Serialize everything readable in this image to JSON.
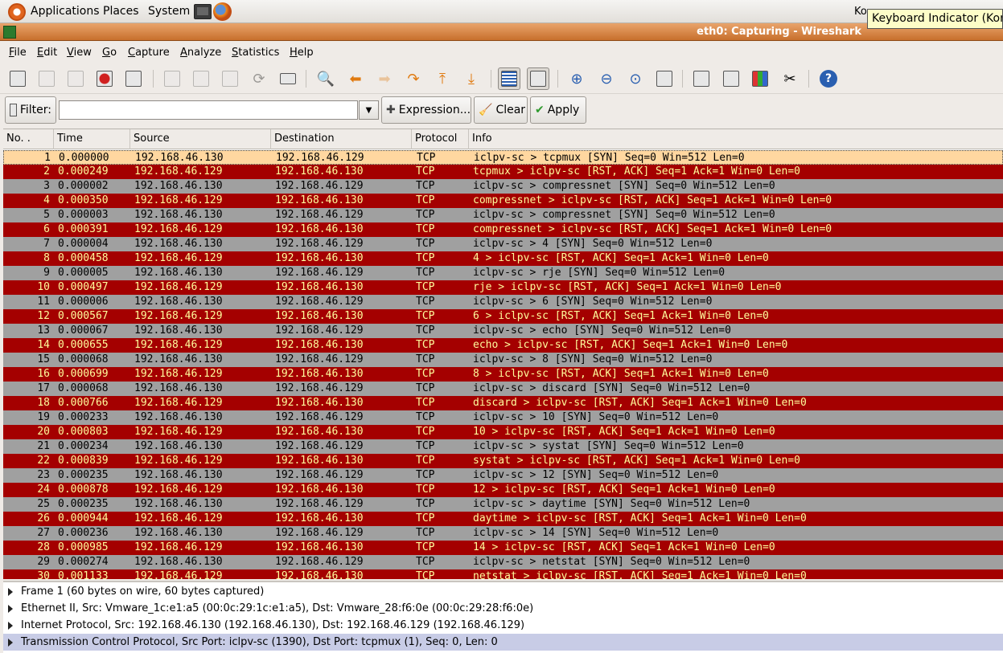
{
  "topbar": {
    "menus": [
      "Applications",
      "Places",
      "System"
    ],
    "tray_text": "Ko",
    "tooltip": "Keyboard Indicator (Korea"
  },
  "window": {
    "title": "eth0: Capturing - Wireshark"
  },
  "menubar": [
    "File",
    "Edit",
    "View",
    "Go",
    "Capture",
    "Analyze",
    "Statistics",
    "Help"
  ],
  "filterbar": {
    "filter_label": "Filter:",
    "filter_value": "",
    "expression_label": "Expression...",
    "clear_label": "Clear",
    "apply_label": "Apply"
  },
  "columns": [
    "No. .",
    "Time",
    "Source",
    "Destination",
    "Protocol",
    "Info"
  ],
  "packets": [
    {
      "no": "1",
      "time": "0.000000",
      "src": "192.168.46.130",
      "dst": "192.168.46.129",
      "proto": "TCP",
      "info": "iclpv-sc > tcpmux [SYN] Seq=0 Win=512 Len=0",
      "kind": "sel"
    },
    {
      "no": "2",
      "time": "0.000249",
      "src": "192.168.46.129",
      "dst": "192.168.46.130",
      "proto": "TCP",
      "info": "tcpmux > iclpv-sc [RST, ACK] Seq=1 Ack=1 Win=0 Len=0",
      "kind": "rst"
    },
    {
      "no": "3",
      "time": "0.000002",
      "src": "192.168.46.130",
      "dst": "192.168.46.129",
      "proto": "TCP",
      "info": "iclpv-sc > compressnet [SYN] Seq=0 Win=512 Len=0",
      "kind": "syn"
    },
    {
      "no": "4",
      "time": "0.000350",
      "src": "192.168.46.129",
      "dst": "192.168.46.130",
      "proto": "TCP",
      "info": "compressnet > iclpv-sc [RST, ACK] Seq=1 Ack=1 Win=0 Len=0",
      "kind": "rst"
    },
    {
      "no": "5",
      "time": "0.000003",
      "src": "192.168.46.130",
      "dst": "192.168.46.129",
      "proto": "TCP",
      "info": "iclpv-sc > compressnet [SYN] Seq=0 Win=512 Len=0",
      "kind": "syn"
    },
    {
      "no": "6",
      "time": "0.000391",
      "src": "192.168.46.129",
      "dst": "192.168.46.130",
      "proto": "TCP",
      "info": "compressnet > iclpv-sc [RST, ACK] Seq=1 Ack=1 Win=0 Len=0",
      "kind": "rst"
    },
    {
      "no": "7",
      "time": "0.000004",
      "src": "192.168.46.130",
      "dst": "192.168.46.129",
      "proto": "TCP",
      "info": "iclpv-sc > 4 [SYN] Seq=0 Win=512 Len=0",
      "kind": "syn"
    },
    {
      "no": "8",
      "time": "0.000458",
      "src": "192.168.46.129",
      "dst": "192.168.46.130",
      "proto": "TCP",
      "info": "4 > iclpv-sc [RST, ACK] Seq=1 Ack=1 Win=0 Len=0",
      "kind": "rst"
    },
    {
      "no": "9",
      "time": "0.000005",
      "src": "192.168.46.130",
      "dst": "192.168.46.129",
      "proto": "TCP",
      "info": "iclpv-sc > rje [SYN] Seq=0 Win=512 Len=0",
      "kind": "syn"
    },
    {
      "no": "10",
      "time": "0.000497",
      "src": "192.168.46.129",
      "dst": "192.168.46.130",
      "proto": "TCP",
      "info": "rje > iclpv-sc [RST, ACK] Seq=1 Ack=1 Win=0 Len=0",
      "kind": "rst"
    },
    {
      "no": "11",
      "time": "0.000006",
      "src": "192.168.46.130",
      "dst": "192.168.46.129",
      "proto": "TCP",
      "info": "iclpv-sc > 6 [SYN] Seq=0 Win=512 Len=0",
      "kind": "syn"
    },
    {
      "no": "12",
      "time": "0.000567",
      "src": "192.168.46.129",
      "dst": "192.168.46.130",
      "proto": "TCP",
      "info": "6 > iclpv-sc [RST, ACK] Seq=1 Ack=1 Win=0 Len=0",
      "kind": "rst"
    },
    {
      "no": "13",
      "time": "0.000067",
      "src": "192.168.46.130",
      "dst": "192.168.46.129",
      "proto": "TCP",
      "info": "iclpv-sc > echo [SYN] Seq=0 Win=512 Len=0",
      "kind": "syn"
    },
    {
      "no": "14",
      "time": "0.000655",
      "src": "192.168.46.129",
      "dst": "192.168.46.130",
      "proto": "TCP",
      "info": "echo > iclpv-sc [RST, ACK] Seq=1 Ack=1 Win=0 Len=0",
      "kind": "rst"
    },
    {
      "no": "15",
      "time": "0.000068",
      "src": "192.168.46.130",
      "dst": "192.168.46.129",
      "proto": "TCP",
      "info": "iclpv-sc > 8 [SYN] Seq=0 Win=512 Len=0",
      "kind": "syn"
    },
    {
      "no": "16",
      "time": "0.000699",
      "src": "192.168.46.129",
      "dst": "192.168.46.130",
      "proto": "TCP",
      "info": "8 > iclpv-sc [RST, ACK] Seq=1 Ack=1 Win=0 Len=0",
      "kind": "rst"
    },
    {
      "no": "17",
      "time": "0.000068",
      "src": "192.168.46.130",
      "dst": "192.168.46.129",
      "proto": "TCP",
      "info": "iclpv-sc > discard [SYN] Seq=0 Win=512 Len=0",
      "kind": "syn"
    },
    {
      "no": "18",
      "time": "0.000766",
      "src": "192.168.46.129",
      "dst": "192.168.46.130",
      "proto": "TCP",
      "info": "discard > iclpv-sc [RST, ACK] Seq=1 Ack=1 Win=0 Len=0",
      "kind": "rst"
    },
    {
      "no": "19",
      "time": "0.000233",
      "src": "192.168.46.130",
      "dst": "192.168.46.129",
      "proto": "TCP",
      "info": "iclpv-sc > 10 [SYN] Seq=0 Win=512 Len=0",
      "kind": "syn"
    },
    {
      "no": "20",
      "time": "0.000803",
      "src": "192.168.46.129",
      "dst": "192.168.46.130",
      "proto": "TCP",
      "info": "10 > iclpv-sc [RST, ACK] Seq=1 Ack=1 Win=0 Len=0",
      "kind": "rst"
    },
    {
      "no": "21",
      "time": "0.000234",
      "src": "192.168.46.130",
      "dst": "192.168.46.129",
      "proto": "TCP",
      "info": "iclpv-sc > systat [SYN] Seq=0 Win=512 Len=0",
      "kind": "syn"
    },
    {
      "no": "22",
      "time": "0.000839",
      "src": "192.168.46.129",
      "dst": "192.168.46.130",
      "proto": "TCP",
      "info": "systat > iclpv-sc [RST, ACK] Seq=1 Ack=1 Win=0 Len=0",
      "kind": "rst"
    },
    {
      "no": "23",
      "time": "0.000235",
      "src": "192.168.46.130",
      "dst": "192.168.46.129",
      "proto": "TCP",
      "info": "iclpv-sc > 12 [SYN] Seq=0 Win=512 Len=0",
      "kind": "syn"
    },
    {
      "no": "24",
      "time": "0.000878",
      "src": "192.168.46.129",
      "dst": "192.168.46.130",
      "proto": "TCP",
      "info": "12 > iclpv-sc [RST, ACK] Seq=1 Ack=1 Win=0 Len=0",
      "kind": "rst"
    },
    {
      "no": "25",
      "time": "0.000235",
      "src": "192.168.46.130",
      "dst": "192.168.46.129",
      "proto": "TCP",
      "info": "iclpv-sc > daytime [SYN] Seq=0 Win=512 Len=0",
      "kind": "syn"
    },
    {
      "no": "26",
      "time": "0.000944",
      "src": "192.168.46.129",
      "dst": "192.168.46.130",
      "proto": "TCP",
      "info": "daytime > iclpv-sc [RST, ACK] Seq=1 Ack=1 Win=0 Len=0",
      "kind": "rst"
    },
    {
      "no": "27",
      "time": "0.000236",
      "src": "192.168.46.130",
      "dst": "192.168.46.129",
      "proto": "TCP",
      "info": "iclpv-sc > 14 [SYN] Seq=0 Win=512 Len=0",
      "kind": "syn"
    },
    {
      "no": "28",
      "time": "0.000985",
      "src": "192.168.46.129",
      "dst": "192.168.46.130",
      "proto": "TCP",
      "info": "14 > iclpv-sc [RST, ACK] Seq=1 Ack=1 Win=0 Len=0",
      "kind": "rst"
    },
    {
      "no": "29",
      "time": "0.000274",
      "src": "192.168.46.130",
      "dst": "192.168.46.129",
      "proto": "TCP",
      "info": "iclpv-sc > netstat [SYN] Seq=0 Win=512 Len=0",
      "kind": "syn"
    },
    {
      "no": "30",
      "time": "0.001133",
      "src": "192.168.46.129",
      "dst": "192.168.46.130",
      "proto": "TCP",
      "info": "netstat > iclpv-sc [RST, ACK] Seq=1 Ack=1 Win=0 Len=0",
      "kind": "rst"
    }
  ],
  "details": [
    "Frame 1 (60 bytes on wire, 60 bytes captured)",
    "Ethernet II, Src: Vmware_1c:e1:a5 (00:0c:29:1c:e1:a5), Dst: Vmware_28:f6:0e (00:0c:29:28:f6:0e)",
    "Internet Protocol, Src: 192.168.46.130 (192.168.46.130), Dst: 192.168.46.129 (192.168.46.129)",
    "Transmission Control Protocol, Src Port: iclpv-sc (1390), Dst Port: tcpmux (1), Seq: 0, Len: 0"
  ],
  "colors": {
    "syn_row": "#a0a0a0",
    "rst_row": "#a40000",
    "rst_text": "#fffc9c",
    "selected_row": "#ffd7a0",
    "titlebar": "#d07a36"
  }
}
